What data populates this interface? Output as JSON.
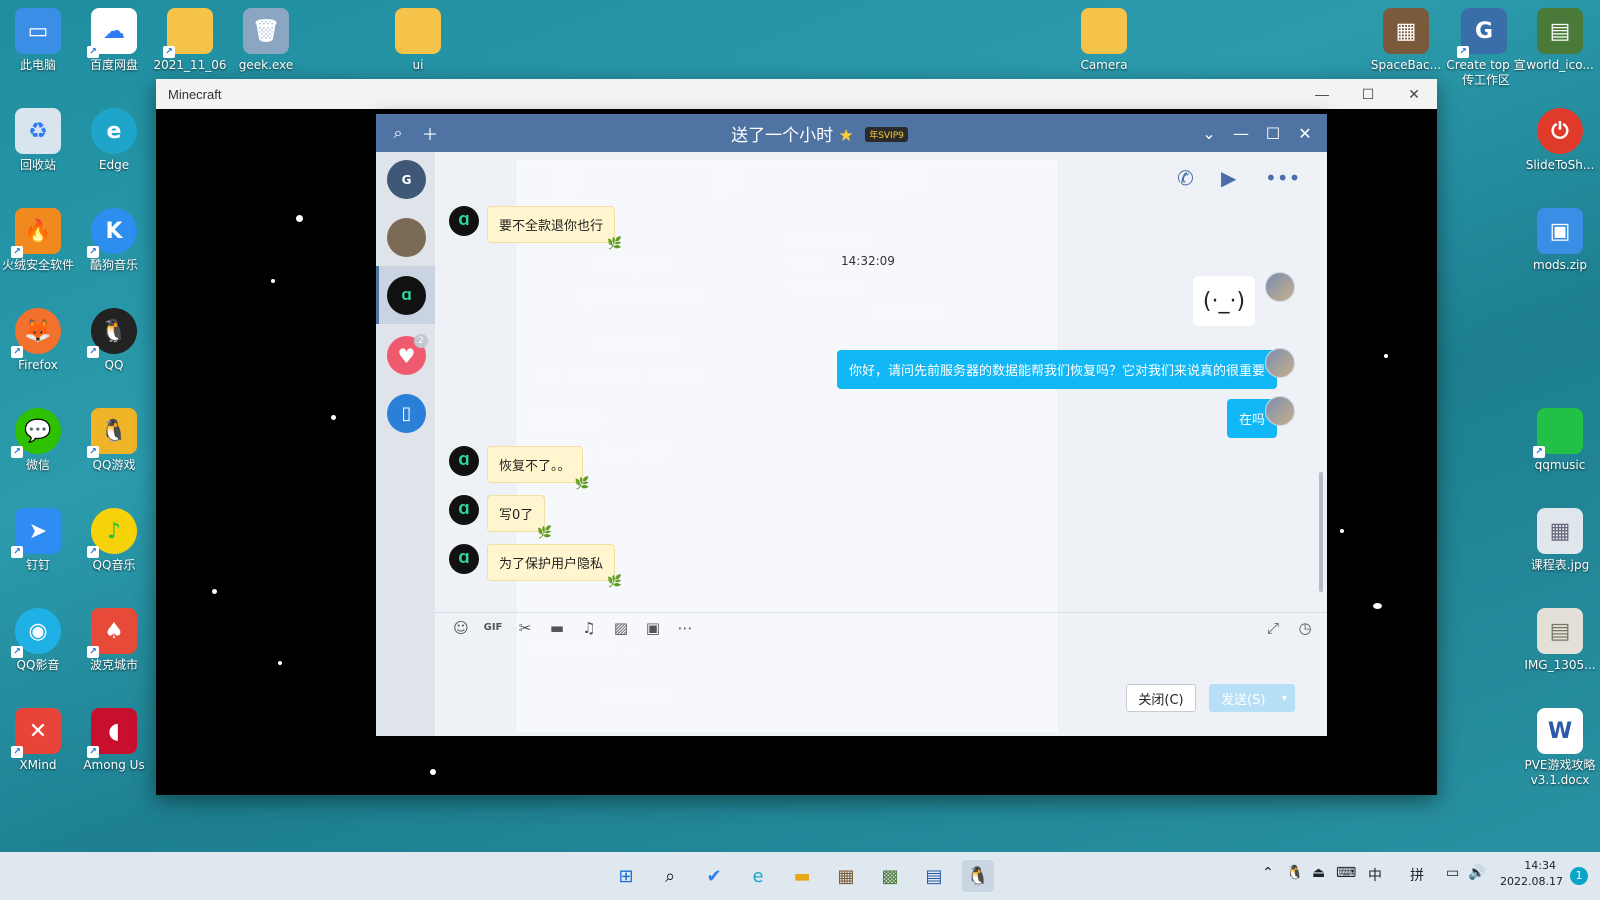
{
  "desktop": {
    "left_icons": [
      {
        "label": "此电脑",
        "icon": "computer-icon",
        "color": "#3a8ee6"
      },
      {
        "label": "百度网盘",
        "icon": "baidu-netdisk-icon",
        "color": "#2f7cf6"
      },
      {
        "label": "2021_11_06",
        "icon": "folder-icon",
        "color": "#f6c34a"
      },
      {
        "label": "geek.exe",
        "icon": "geek-uninstaller-icon",
        "color": "#8aa6c2"
      },
      {
        "label": "ui",
        "icon": "folder-icon",
        "color": "#f6c34a"
      },
      {
        "label": "回收站",
        "icon": "recycle-bin-icon",
        "color": "#d8e4ee"
      },
      {
        "label": "Edge",
        "icon": "edge-icon",
        "color": "#1fa5c9"
      },
      {
        "label": "火绒安全软件",
        "icon": "huorong-icon",
        "color": "#f08a1e"
      },
      {
        "label": "酷狗音乐",
        "icon": "kugou-icon",
        "color": "#2d8ef0"
      },
      {
        "label": "Firefox",
        "icon": "firefox-icon",
        "color": "#f2712c"
      },
      {
        "label": "QQ",
        "icon": "qq-icon",
        "color": "#222222"
      },
      {
        "label": "微信",
        "icon": "wechat-icon",
        "color": "#2dc100"
      },
      {
        "label": "QQ游戏",
        "icon": "qq-game-icon",
        "color": "#f0b429"
      },
      {
        "label": "钉钉",
        "icon": "dingtalk-icon",
        "color": "#2f8cf2"
      },
      {
        "label": "QQ音乐",
        "icon": "qq-music-icon",
        "color": "#f5d20a"
      },
      {
        "label": "QQ影音",
        "icon": "qq-player-icon",
        "color": "#1fb1e6"
      },
      {
        "label": "波克城市",
        "icon": "poker-city-icon",
        "color": "#e84a3a"
      },
      {
        "label": "XMind",
        "icon": "xmind-icon",
        "color": "#e8443a"
      },
      {
        "label": "Among Us",
        "icon": "among-us-icon",
        "color": "#c8102e"
      },
      {
        "label": "Camera",
        "icon": "folder-icon",
        "color": "#f6c34a"
      }
    ],
    "right_icons": [
      {
        "label": "SpaceBac...",
        "icon": "grass-block-icon",
        "color": "#7a5a3a"
      },
      {
        "label": "Create top 宣传工作区",
        "icon": "create-top-icon",
        "color": "#3a6ea8"
      },
      {
        "label": "world_ico...",
        "icon": "world-icon",
        "color": "#4a7a3a"
      },
      {
        "label": "SlideToSh...",
        "icon": "power-icon",
        "color": "#e03a2a"
      },
      {
        "label": "mods.zip",
        "icon": "zip-icon",
        "color": "#3a8ee6"
      },
      {
        "label": "qqmusic",
        "icon": "folder-icon",
        "color": "#22c046"
      },
      {
        "label": "课程表.jpg",
        "icon": "image-icon",
        "color": "#dfe6ec"
      },
      {
        "label": "IMG_1305...",
        "icon": "image-icon",
        "color": "#e4e0d8"
      },
      {
        "label": "PVE游戏攻略 v3.1.docx",
        "icon": "word-icon",
        "color": "#2b5aa8"
      }
    ]
  },
  "minecraft": {
    "title": "Minecraft",
    "ghost_tabs": [
      "世界",
      "11",
      "好友",
      "0",
      "服务器",
      "11"
    ],
    "ghost_servers": [
      "Mineplex",
      "SpeedBuilders",
      "CubeCraft",
      "EU: SKYWARS DUELS",
      "其他服务器",
      "Create top-VPS",
      "ModsCraf..."
    ],
    "ghost_detail": {
      "name": "CT空岛生存",
      "online_label": "在线：",
      "online_value": "14:32:09",
      "ping_label": "当前Ping：",
      "join_label": "加入服务器",
      "add_label": "添加服务器"
    }
  },
  "qq": {
    "title": "送了一个小时",
    "svip": "年SVIP9",
    "messages_in": [
      {
        "text": "要不全款退你也行"
      },
      {
        "text": "恢复不了。。"
      },
      {
        "text": "写0了"
      },
      {
        "text": "为了保护用户隐私"
      }
    ],
    "messages_out": [
      {
        "text": "你好，请问先前服务器的数据能帮我们恢复吗？它对我们来说真的很重要"
      },
      {
        "text": "在吗"
      }
    ],
    "close_label": "关闭(C)",
    "send_label": "发送(S)",
    "badge_count": "2",
    "toolbar_icons": [
      "emoji-icon",
      "gif-icon",
      "scissors-icon",
      "folder-icon",
      "mic-icon",
      "image-icon",
      "screen-icon",
      "more-icon"
    ]
  },
  "taskbar": {
    "apps": [
      "start-icon",
      "search-icon",
      "todo-icon",
      "edge-icon",
      "file-explorer-icon",
      "chest-icon",
      "minecraft-icon",
      "network-icon",
      "qq-icon"
    ],
    "ime_1": "中",
    "ime_2": "拼",
    "time": "14:34",
    "date": "2022.08.17",
    "notifications": "1"
  }
}
